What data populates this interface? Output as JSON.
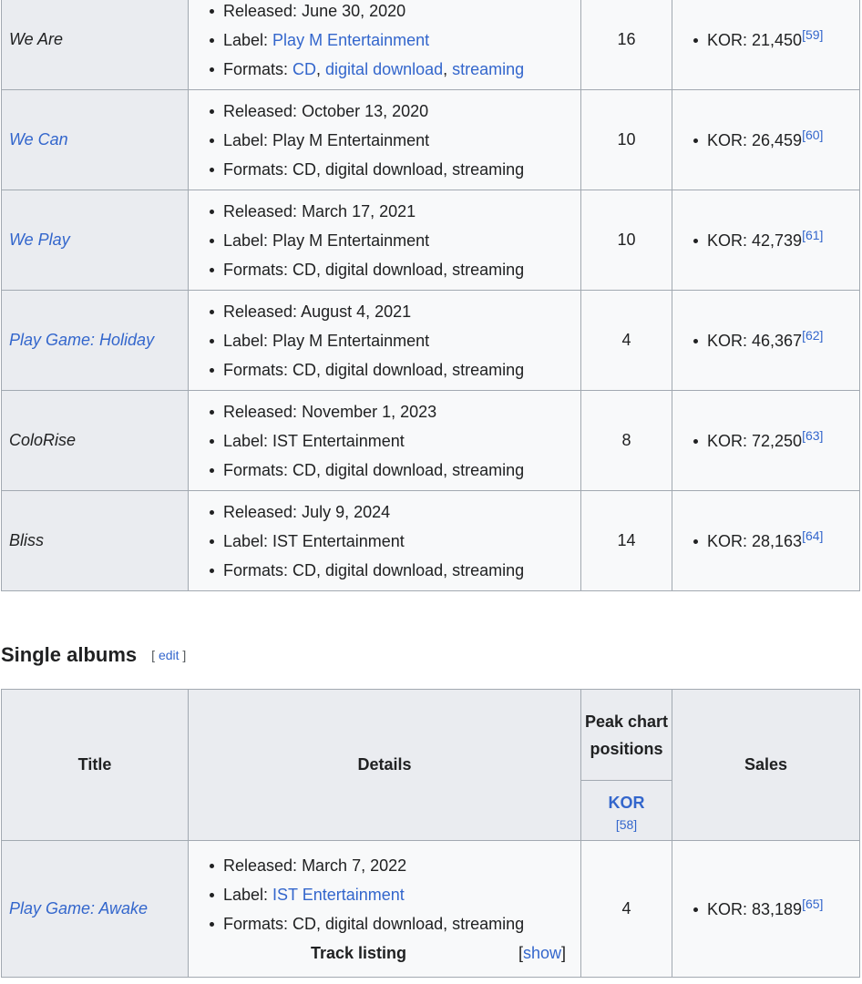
{
  "studio_albums": [
    {
      "title": "We Are",
      "title_is_link": false,
      "released": "June 30, 2020",
      "label": "Play M Entertainment",
      "label_is_link": true,
      "formats": [
        {
          "t": "CD",
          "link": true
        },
        {
          "t": "digital download",
          "link": true
        },
        {
          "t": "streaming",
          "link": true
        }
      ],
      "peak": "16",
      "sales": "KOR: 21,450",
      "ref": "[59]"
    },
    {
      "title": "We Can",
      "title_is_link": true,
      "released": "October 13, 2020",
      "label": "Play M Entertainment",
      "label_is_link": false,
      "formats": [
        {
          "t": "CD",
          "link": false
        },
        {
          "t": "digital download",
          "link": false
        },
        {
          "t": "streaming",
          "link": false
        }
      ],
      "peak": "10",
      "sales": "KOR: 26,459",
      "ref": "[60]"
    },
    {
      "title": "We Play",
      "title_is_link": true,
      "released": "March 17, 2021",
      "label": "Play M Entertainment",
      "label_is_link": false,
      "formats": [
        {
          "t": "CD",
          "link": false
        },
        {
          "t": "digital download",
          "link": false
        },
        {
          "t": "streaming",
          "link": false
        }
      ],
      "peak": "10",
      "sales": "KOR: 42,739",
      "ref": "[61]"
    },
    {
      "title": "Play Game: Holiday",
      "title_is_link": true,
      "released": "August 4, 2021",
      "label": "Play M Entertainment",
      "label_is_link": false,
      "formats": [
        {
          "t": "CD",
          "link": false
        },
        {
          "t": "digital download",
          "link": false
        },
        {
          "t": "streaming",
          "link": false
        }
      ],
      "peak": "4",
      "sales": "KOR: 46,367",
      "ref": "[62]"
    },
    {
      "title": "ColoRise",
      "title_is_link": false,
      "released": "November 1, 2023",
      "label": "IST Entertainment",
      "label_is_link": false,
      "formats": [
        {
          "t": "CD",
          "link": false
        },
        {
          "t": "digital download",
          "link": false
        },
        {
          "t": "streaming",
          "link": false
        }
      ],
      "peak": "8",
      "sales": "KOR: 72,250",
      "ref": "[63]"
    },
    {
      "title": "Bliss",
      "title_is_link": false,
      "released": "July 9, 2024",
      "label": "IST Entertainment",
      "label_is_link": false,
      "formats": [
        {
          "t": "CD",
          "link": false
        },
        {
          "t": "digital download",
          "link": false
        },
        {
          "t": "streaming",
          "link": false
        }
      ],
      "peak": "14",
      "sales": "KOR: 28,163",
      "ref": "[64]"
    }
  ],
  "labels": {
    "released": "Released: ",
    "label": "Label: ",
    "formats": "Formats: "
  },
  "single_section": {
    "heading": "Single albums",
    "edit_open": "[ ",
    "edit": "edit",
    "edit_close": " ]",
    "headers": {
      "title": "Title",
      "details": "Details",
      "peak": "Peak chart positions",
      "kor": "KOR",
      "kor_ref": "[58]",
      "sales": "Sales"
    },
    "rows": [
      {
        "title": "Play Game: Awake",
        "released": "March 7, 2022",
        "label": "IST Entertainment",
        "formats": "CD, digital download, streaming",
        "track_listing": "Track listing",
        "show_open": "[",
        "show": "show",
        "show_close": "]",
        "peak": "4",
        "sales": "KOR: 83,189",
        "ref": "[65]"
      }
    ]
  }
}
